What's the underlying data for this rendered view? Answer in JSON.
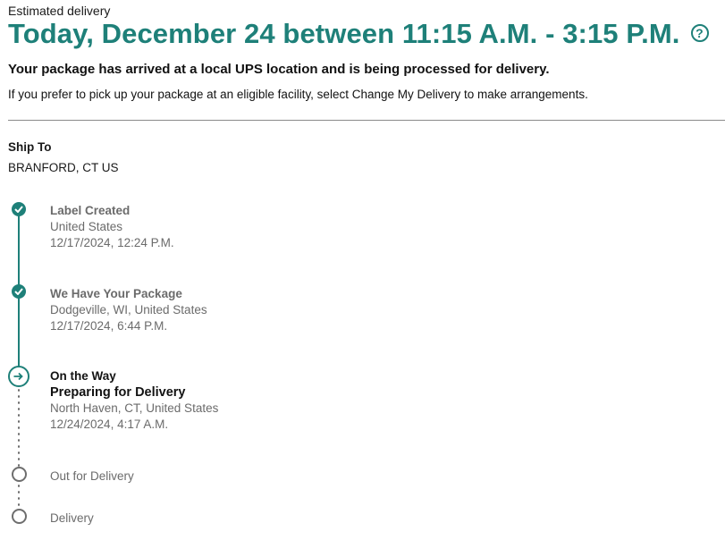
{
  "header": {
    "estimated_label": "Estimated delivery",
    "estimated_date": "Today, December 24 between 11:15 A.M. - 3:15 P.M.",
    "help_glyph": "?",
    "status_message": "Your package has arrived at a local UPS location and is being processed for delivery.",
    "info_message": "If you prefer to pick up your package at an eligible facility, select Change My Delivery to make arrangements."
  },
  "ship_to": {
    "label": "Ship To",
    "value": "BRANFORD, CT US"
  },
  "timeline": [
    {
      "state": "done",
      "title": "Label Created",
      "location": "United States",
      "time": "12/17/2024, 12:24 P.M."
    },
    {
      "state": "done",
      "title": "We Have Your Package",
      "location": "Dodgeville, WI, United States",
      "time": "12/17/2024, 6:44 P.M."
    },
    {
      "state": "current",
      "title": "On the Way",
      "subtitle": "Preparing for Delivery",
      "location": "North Haven, CT, United States",
      "time": "12/24/2024, 4:17 A.M."
    },
    {
      "state": "pending",
      "title": "Out for Delivery"
    },
    {
      "state": "pending",
      "title": "Delivery"
    }
  ],
  "colors": {
    "accent": "#1e8079",
    "muted_text": "#6b6b6b",
    "divider": "#8a8a8a"
  },
  "icons": {
    "completed": "check-circle-icon",
    "current": "arrow-right-circle-icon",
    "pending": "empty-circle-icon",
    "help": "question-circle-icon"
  }
}
